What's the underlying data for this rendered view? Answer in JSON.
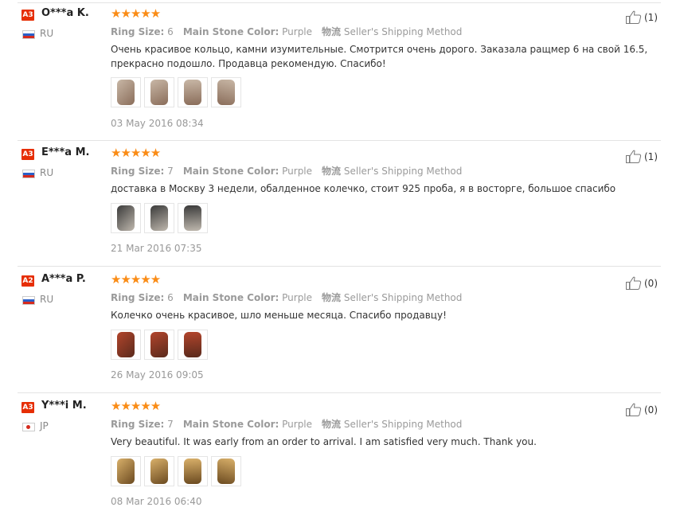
{
  "labels": {
    "ring_size": "Ring Size:",
    "main_stone_color": "Main Stone Color:",
    "shipping_label": "物流"
  },
  "reviews": [
    {
      "level": "A3",
      "name": "O***a K.",
      "country": "RU",
      "rating": 5,
      "ring_size": "6",
      "main_stone_color": "Purple",
      "shipping": "Seller's Shipping Method",
      "text": "Очень красивое кольцо, камни изумительные. Смотрится очень дорого. Заказала ращмер 6 на свой 16.5, прекрасно подошло. Продавца рекомендую. Спасибо!",
      "photo_count": 4,
      "date": "03 May 2016 08:34",
      "helpful": "(1)"
    },
    {
      "level": "A3",
      "name": "E***a M.",
      "country": "RU",
      "rating": 5,
      "ring_size": "7",
      "main_stone_color": "Purple",
      "shipping": "Seller's Shipping Method",
      "text": "доставка в Москву 3 недели, обалденное колечко, стоит 925 проба, я в восторге, большое спасибо",
      "photo_count": 3,
      "date": "21 Mar 2016 07:35",
      "helpful": "(1)"
    },
    {
      "level": "A2",
      "name": "A***a P.",
      "country": "RU",
      "rating": 5,
      "ring_size": "6",
      "main_stone_color": "Purple",
      "shipping": "Seller's Shipping Method",
      "text": "Колечко очень красивое, шло меньше месяца. Спасибо продавцу!",
      "photo_count": 3,
      "date": "26 May 2016 09:05",
      "helpful": "(0)"
    },
    {
      "level": "A3",
      "name": "Y***i M.",
      "country": "JP",
      "rating": 5,
      "ring_size": "7",
      "main_stone_color": "Purple",
      "shipping": "Seller's Shipping Method",
      "text": "Very beautiful. It was early from an order to arrival. I am satisfied very much. Thank you.",
      "photo_count": 4,
      "date": "08 Mar 2016 06:40",
      "helpful": "(0)"
    }
  ],
  "colors": {
    "accent": "#e62e04",
    "star": "#fa8c16"
  },
  "icons": {
    "helpful": "thumbs-up-icon",
    "rating": "star-icon"
  }
}
